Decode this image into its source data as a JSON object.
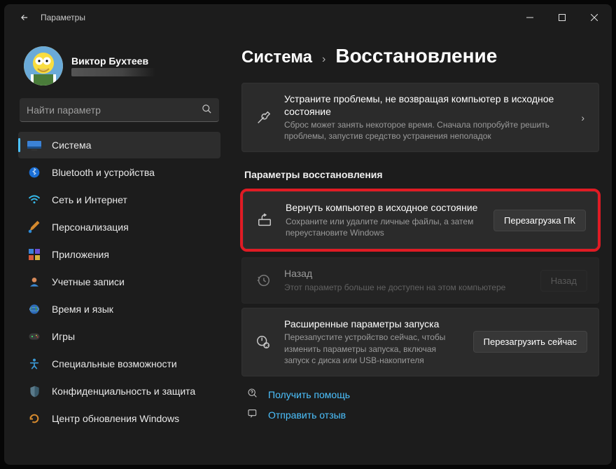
{
  "window": {
    "title": "Параметры"
  },
  "profile": {
    "name": "Виктор Бухтеев"
  },
  "search": {
    "placeholder": "Найти параметр"
  },
  "nav": [
    {
      "label": "Система",
      "active": true
    },
    {
      "label": "Bluetooth и устройства"
    },
    {
      "label": "Сеть и Интернет"
    },
    {
      "label": "Персонализация"
    },
    {
      "label": "Приложения"
    },
    {
      "label": "Учетные записи"
    },
    {
      "label": "Время и язык"
    },
    {
      "label": "Игры"
    },
    {
      "label": "Специальные возможности"
    },
    {
      "label": "Конфиденциальность и защита"
    },
    {
      "label": "Центр обновления Windows"
    }
  ],
  "breadcrumb": {
    "parent": "Система",
    "current": "Восстановление"
  },
  "banner": {
    "title": "Устраните проблемы, не возвращая компьютер в исходное состояние",
    "desc": "Сброс может занять некоторое время. Сначала попробуйте решить проблемы, запустив средство устранения неполадок"
  },
  "section": {
    "heading": "Параметры восстановления"
  },
  "cards": {
    "reset": {
      "title": "Вернуть компьютер в исходное состояние",
      "desc": "Сохраните или удалите личные файлы, а затем переустановите Windows",
      "button": "Перезагрузка ПК"
    },
    "goback": {
      "title": "Назад",
      "desc": "Этот параметр больше не доступен на этом компьютере",
      "button": "Назад"
    },
    "advanced": {
      "title": "Расширенные параметры запуска",
      "desc": "Перезапустите устройство сейчас, чтобы изменить параметры запуска, включая запуск с диска или USB-накопителя",
      "button": "Перезагрузить сейчас"
    }
  },
  "footer": {
    "help": "Получить помощь",
    "feedback": "Отправить отзыв"
  }
}
